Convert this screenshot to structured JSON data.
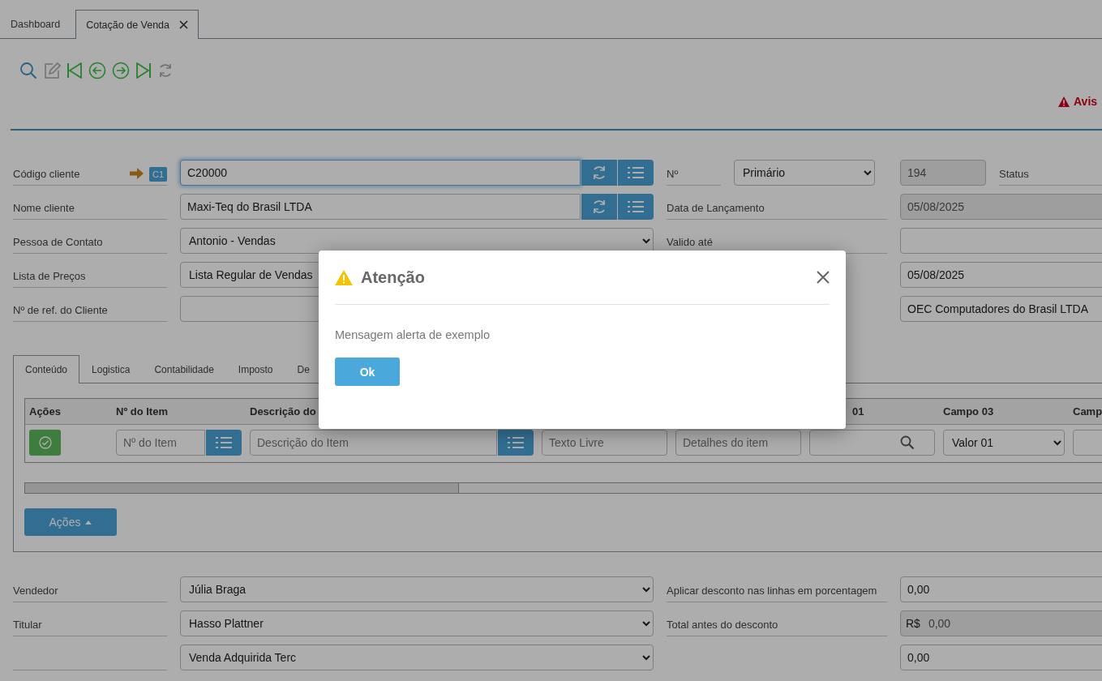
{
  "tabs": [
    {
      "label": "Dashboard",
      "selected": false,
      "closable": false
    },
    {
      "label": "Cotação de Venda",
      "selected": true,
      "closable": true
    }
  ],
  "toolbar": [
    {
      "kind": "search",
      "disabled": false
    },
    {
      "kind": "edit",
      "disabled": true
    },
    {
      "kind": "first",
      "disabled": false
    },
    {
      "kind": "previous",
      "disabled": false
    },
    {
      "kind": "next",
      "disabled": false
    },
    {
      "kind": "last",
      "disabled": false
    },
    {
      "kind": "refresh",
      "disabled": true
    }
  ],
  "warning": {
    "label": "Avis"
  },
  "header_rows": [
    {
      "label": "Código cliente",
      "badge": "C1",
      "field": {
        "kind": "lookup",
        "value": "C20000",
        "focused": true
      },
      "label_2": "Nº",
      "field_2": {
        "kind": "select",
        "value": "Primário"
      },
      "field_3": {
        "kind": "readonly",
        "value": "194"
      },
      "label_3": "Status"
    },
    {
      "label": "Nome cliente",
      "field": {
        "kind": "lookup",
        "value": "Maxi-Teq do Brasil LTDA",
        "focused": false
      },
      "label_2": "Data de Lançamento",
      "field_3": {
        "kind": "readonly",
        "value": "05/08/2025"
      }
    },
    {
      "label": "Pessoa de Contato",
      "field": {
        "kind": "select",
        "value": "Antonio - Vendas"
      },
      "label_2": "Valido até",
      "field_3": {
        "kind": "text"
      }
    },
    {
      "label": "Lista de Preços",
      "field": {
        "kind": "select",
        "value": "Lista Regular de Vendas"
      },
      "field_3": {
        "kind": "text",
        "value": "05/08/2025"
      }
    },
    {
      "label": "Nº de ref. do Cliente",
      "field": {
        "kind": "text"
      },
      "field_3": {
        "kind": "text",
        "value": "OEC Computadores do Brasil LTDA"
      }
    }
  ],
  "item_tabs": [
    {
      "label": "Conteúdo",
      "selected": true
    },
    {
      "label": "Logistica",
      "selected": false
    },
    {
      "label": "Contabilidade",
      "selected": false
    },
    {
      "label": "Imposto",
      "selected": false
    },
    {
      "label": "De",
      "selected": false
    }
  ],
  "item_table": {
    "columns": [
      {
        "label": "Ações"
      },
      {
        "label": "Nº do Item"
      },
      {
        "label": "Descrição do"
      },
      {},
      {},
      {
        "label": "01"
      },
      {
        "label": "Campo 03"
      },
      {
        "label": "Camp"
      }
    ],
    "row": [
      {
        "kind": "action_button"
      },
      {
        "kind": "lookup",
        "placeholder": "Nº do Item"
      },
      {
        "kind": "lookup",
        "placeholder": "Descrição do Item"
      },
      {
        "kind": "text",
        "placeholder": "Texto Livre"
      },
      {
        "kind": "text",
        "placeholder": "Detalhes do item"
      },
      {
        "kind": "search"
      },
      {
        "kind": "select",
        "value": "Valor 01"
      },
      {
        "kind": "text"
      }
    ]
  },
  "actions_button": {
    "label": "Ações"
  },
  "bottom_rows": [
    {
      "label": "Vendedor",
      "field": {
        "kind": "select",
        "value": "Júlia Braga"
      },
      "label_2": "Aplicar desconto nas linhas em porcentagem",
      "field_3": {
        "kind": "text",
        "value": "0,00"
      }
    },
    {
      "label": "Titular",
      "field": {
        "kind": "select",
        "value": "Hasso Plattner"
      },
      "label_2": "Total antes do desconto",
      "field_3": {
        "kind": "currency",
        "prefix": "R$",
        "value": "0,00"
      }
    },
    {
      "field": {
        "kind": "select",
        "value": "Venda Adquirida Terc"
      },
      "field_3": {
        "kind": "text",
        "value": "0,00"
      }
    }
  ],
  "modal": {
    "title": "Atenção",
    "message": "Mensagem alerta de exemplo",
    "button": "Ok"
  }
}
